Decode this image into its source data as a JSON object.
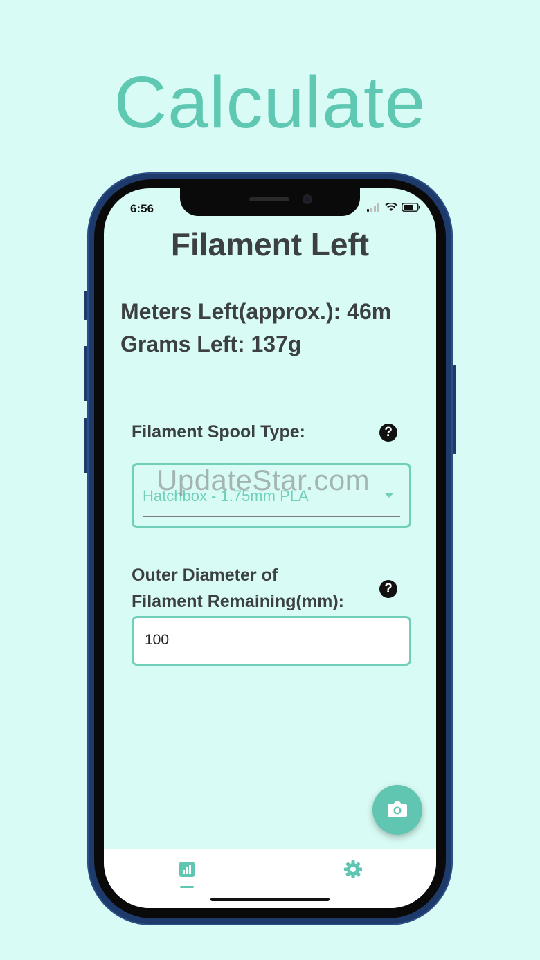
{
  "headline": "Calculate",
  "status_bar": {
    "time": "6:56"
  },
  "app": {
    "title": "Filament Left",
    "results": {
      "meters_left": "Meters Left(approx.): 46m",
      "grams_left": "Grams Left: 137g"
    },
    "spool_type": {
      "label": "Filament Spool Type:",
      "selected_value": "Hatchbox - 1.75mm PLA"
    },
    "outer_diameter": {
      "label_line1": "Outer Diameter of",
      "label_line2": "Filament Remaining(mm):",
      "value": "100"
    },
    "help_glyph": "?"
  },
  "watermark": "UpdateStar.com",
  "bottom_nav": {
    "items": [
      {
        "icon": "chart-icon",
        "active": true
      },
      {
        "icon": "gear-icon",
        "active": false
      }
    ]
  },
  "fab": {
    "icon": "camera-icon"
  },
  "colors": {
    "background": "#d8fcf5",
    "accent": "#61c6b1",
    "text": "#3d4043",
    "phone_frame": "#1d3a6b"
  }
}
